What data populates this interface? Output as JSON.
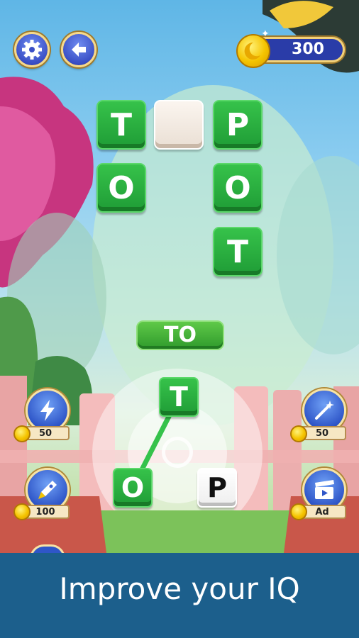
{
  "coins": {
    "amount": "300"
  },
  "board": {
    "row1": [
      "T",
      "",
      "P"
    ],
    "row2": [
      "O",
      "O"
    ],
    "row3": [
      "T"
    ]
  },
  "current_word": "TO",
  "wheel": {
    "letters": [
      "T",
      "O",
      "P"
    ]
  },
  "powerups": {
    "hint_price": "50",
    "magic_price": "50",
    "rocket_price": "100",
    "video_label": "Ad"
  },
  "banner": {
    "tagline": "Improve your IQ"
  },
  "colors": {
    "tile_green": "#2aae40",
    "banner_blue": "#1c5f8c",
    "button_blue": "#3a4fc6"
  },
  "icons": [
    "gear-icon",
    "back-arrow-icon",
    "coin-icon",
    "lightning-icon",
    "magic-wand-icon",
    "rocket-icon",
    "video-clapper-icon"
  ]
}
